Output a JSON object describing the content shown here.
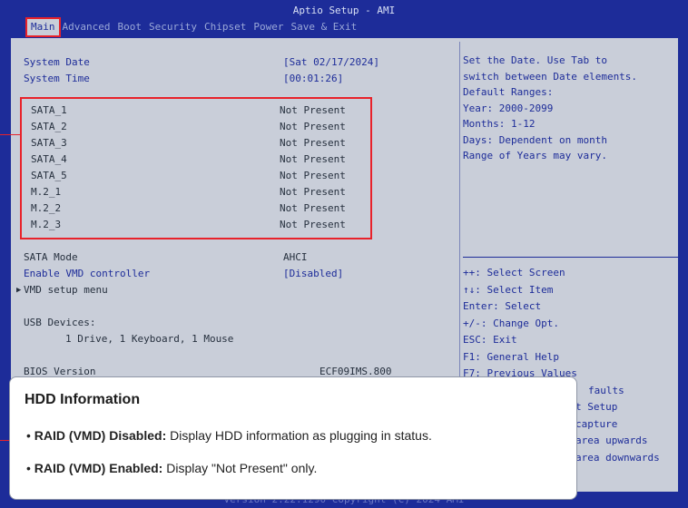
{
  "window": {
    "title": "Aptio Setup - AMI"
  },
  "menu": [
    "Main",
    "Advanced",
    "Boot",
    "Security",
    "Chipset",
    "Power",
    "Save & Exit"
  ],
  "main": {
    "system_date": {
      "label": "System Date",
      "value": "[Sat 02/17/2024]"
    },
    "system_time": {
      "label": "System Time",
      "value": "[00:01:26]"
    },
    "drives": [
      {
        "name": "SATA_1",
        "status": "Not Present"
      },
      {
        "name": "SATA_2",
        "status": "Not Present"
      },
      {
        "name": "SATA_3",
        "status": "Not Present"
      },
      {
        "name": "SATA_4",
        "status": "Not Present"
      },
      {
        "name": "SATA_5",
        "status": "Not Present"
      },
      {
        "name": "M.2_1",
        "status": "Not Present"
      },
      {
        "name": "M.2_2",
        "status": "Not Present"
      },
      {
        "name": "M.2_3",
        "status": "Not Present"
      }
    ],
    "sata_mode": {
      "label": "SATA Mode",
      "value": "AHCI"
    },
    "vmd": {
      "label": "Enable VMD controller",
      "value": "[Disabled]"
    },
    "vmd_menu": {
      "label": "VMD setup menu",
      "arrow": "▶"
    },
    "usb": {
      "label": "USB Devices:",
      "value": "1 Drive, 1 Keyboard, 1 Mouse"
    },
    "bios": {
      "label": "BIOS Version",
      "value": "ECF09IMS.800"
    }
  },
  "help": [
    "Set the Date. Use Tab to",
    "switch between Date elements.",
    "Default Ranges:",
    "Year: 2000-2099",
    "Months: 1-12",
    "Days: Dependent on month",
    "Range of Years may vary."
  ],
  "keys": [
    "++: Select Screen",
    "↑↓: Select Item",
    "Enter: Select",
    "+/-: Change Opt.",
    "ESC: Exit",
    "F1: General Help",
    "F7: Previous Values",
    "faults",
    "t Setup",
    "capture",
    "area upwards",
    "area downwards"
  ],
  "footer": "Version 2.22.1290 Copyright (C) 2024 AMI",
  "popup": {
    "title": "HDD Information",
    "items": [
      {
        "term": "RAID (VMD) Disabled:",
        "desc": " Display HDD information as plugging in status."
      },
      {
        "term": "RAID (VMD) Enabled:",
        "desc": " Display \"Not Present\" only."
      }
    ]
  },
  "colors": {
    "bios_blue": "#1d2c99",
    "panel": "#c9ced9",
    "highlight": "#e8222a"
  }
}
